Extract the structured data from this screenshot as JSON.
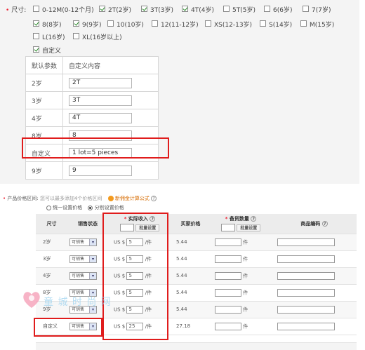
{
  "size": {
    "label": "尺寸",
    "options": [
      {
        "label": "0-12M(0-12个月)",
        "checked": false
      },
      {
        "label": "2T(2岁)",
        "checked": true
      },
      {
        "label": "3T(3岁)",
        "checked": true
      },
      {
        "label": "4T(4岁)",
        "checked": true
      },
      {
        "label": "5T(5岁)",
        "checked": false
      },
      {
        "label": "6(6岁)",
        "checked": false
      },
      {
        "label": "7(7岁)",
        "checked": false
      },
      {
        "label": "8(8岁)",
        "checked": true
      },
      {
        "label": "9(9岁)",
        "checked": true
      },
      {
        "label": "10(10岁)",
        "checked": false
      },
      {
        "label": "12(11-12岁)",
        "checked": false
      },
      {
        "label": "XS(12-13岁)",
        "checked": false
      },
      {
        "label": "S(14岁)",
        "checked": false
      },
      {
        "label": "M(15岁)",
        "checked": false
      },
      {
        "label": "L(16岁)",
        "checked": false
      },
      {
        "label": "XL(16岁以上)",
        "checked": false
      }
    ],
    "custom_label": "自定义",
    "custom_checked": true
  },
  "custom_table": {
    "headers": [
      "默认参数",
      "自定义内容"
    ],
    "rows": [
      {
        "param": "2岁",
        "value": "2T"
      },
      {
        "param": "3岁",
        "value": "3T"
      },
      {
        "param": "4岁",
        "value": "4T"
      },
      {
        "param": "8岁",
        "value": "8"
      },
      {
        "param": "自定义",
        "value": "1 lot=5 pieces"
      },
      {
        "param": "9岁",
        "value": "9"
      }
    ]
  },
  "pricing": {
    "label": "产品价格区间",
    "hint": "您可以最多添加4个价格区间",
    "formula_link": "新佣金计算公式",
    "radio_unified": "统一设置价格",
    "radio_separate": "分别设置价格",
    "headers": {
      "size": "尺寸",
      "status": "销售状态",
      "income": "实际收入",
      "buyer_price": "买家价格",
      "stock": "备货数量",
      "code": "商品编码"
    },
    "batch_label": "批量设置",
    "currency": "US $",
    "per_unit": "/件",
    "stock_unit": "件",
    "rows": [
      {
        "size": "2岁",
        "status": "可销售",
        "income": "5",
        "buyer": "5.44"
      },
      {
        "size": "3岁",
        "status": "可销售",
        "income": "5",
        "buyer": "5.44"
      },
      {
        "size": "4岁",
        "status": "可销售",
        "income": "5",
        "buyer": "5.44"
      },
      {
        "size": "8岁",
        "status": "可销售",
        "income": "5",
        "buyer": "5.44"
      },
      {
        "size": "9岁",
        "status": "可销售",
        "income": "5",
        "buyer": "5.44"
      },
      {
        "size": "自定义",
        "status": "可销售",
        "income": "25",
        "buyer": "27.18"
      }
    ]
  },
  "watermark": "童 城 时 尚 网"
}
